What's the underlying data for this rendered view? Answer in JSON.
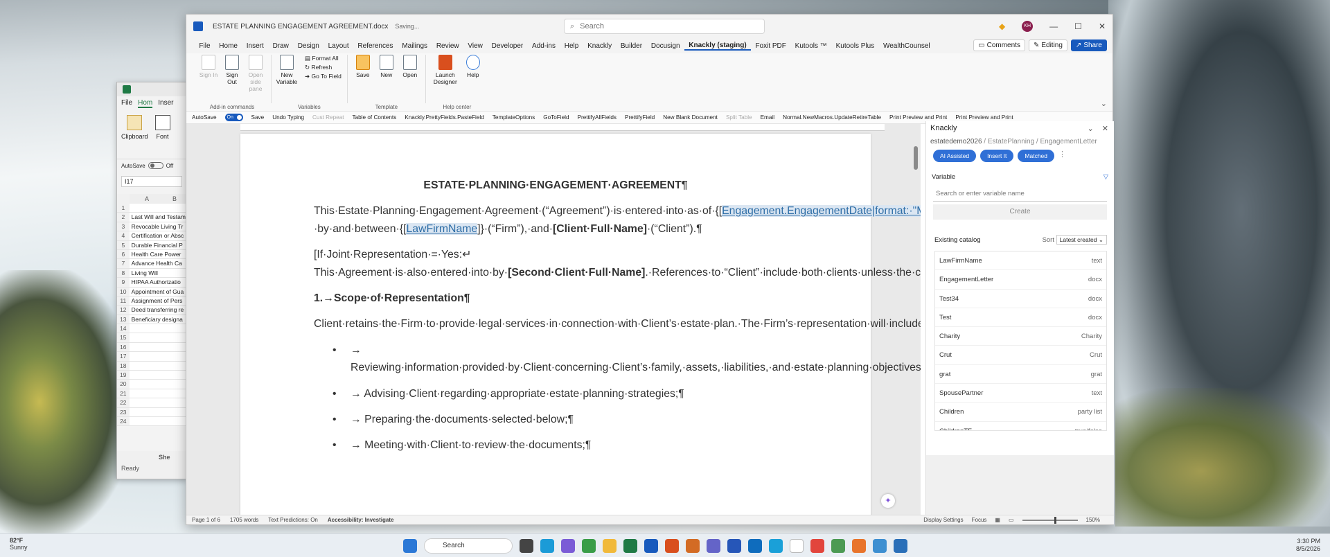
{
  "excel": {
    "tabs": [
      "File",
      "Hom",
      "Inser"
    ],
    "ribbon": [
      "Clipboard",
      "Font"
    ],
    "autosave": "AutoSave",
    "autosave_state": "Off",
    "namebox": "I17",
    "cols": [
      "A",
      "B"
    ],
    "rows": [
      {
        "n": "1",
        "v": ""
      },
      {
        "n": "2",
        "v": "Last Will and Testam"
      },
      {
        "n": "3",
        "v": "Revocable Living Tr"
      },
      {
        "n": "4",
        "v": "Certification or Absc"
      },
      {
        "n": "5",
        "v": "Durable Financial P"
      },
      {
        "n": "6",
        "v": "Health Care Power"
      },
      {
        "n": "7",
        "v": "Advance Health Ca"
      },
      {
        "n": "8",
        "v": "Living Will"
      },
      {
        "n": "9",
        "v": "HIPAA Authorizatio"
      },
      {
        "n": "10",
        "v": "Appointment of Gua"
      },
      {
        "n": "11",
        "v": "Assignment of Pers"
      },
      {
        "n": "12",
        "v": "Deed transferring re"
      },
      {
        "n": "13",
        "v": "Beneficiary designa"
      },
      {
        "n": "14",
        "v": ""
      },
      {
        "n": "15",
        "v": ""
      },
      {
        "n": "16",
        "v": ""
      },
      {
        "n": "17",
        "v": ""
      },
      {
        "n": "18",
        "v": ""
      },
      {
        "n": "19",
        "v": ""
      },
      {
        "n": "20",
        "v": ""
      },
      {
        "n": "21",
        "v": ""
      },
      {
        "n": "22",
        "v": ""
      },
      {
        "n": "23",
        "v": ""
      },
      {
        "n": "24",
        "v": ""
      }
    ],
    "status": "Ready",
    "sheet": "She"
  },
  "word": {
    "title": "ESTATE PLANNING ENGAGEMENT AGREEMENT.docx",
    "saving": "Saving...",
    "search_placeholder": "Search",
    "avatar": "KH",
    "menus": [
      "File",
      "Home",
      "Insert",
      "Draw",
      "Design",
      "Layout",
      "References",
      "Mailings",
      "Review",
      "View",
      "Developer",
      "Add-ins",
      "Help",
      "Knackly",
      "Builder",
      "Docusign",
      "Knackly (staging)",
      "Foxit PDF",
      "Kutools ™",
      "Kutools Plus",
      "WealthCounsel"
    ],
    "comments": "Comments",
    "editing": "Editing",
    "share": "Share",
    "ribbon": {
      "g1": {
        "label": "Add-in commands",
        "btns": [
          "Sign In",
          "Sign Out",
          "Open side pane"
        ]
      },
      "g2": {
        "label": "Variables",
        "btn": "New Variable",
        "small": [
          "Format All",
          "Refresh",
          "Go To Field"
        ]
      },
      "g3": {
        "label": "Template",
        "btns": [
          "Save",
          "New",
          "Open"
        ]
      },
      "g4": {
        "label": "Help center",
        "btns": [
          "Launch Designer",
          "Help"
        ]
      }
    },
    "qat": {
      "autosave": "AutoSave",
      "on": "On",
      "items": [
        "Save",
        "Undo Typing",
        "Cust Repeat",
        "Table of Contents",
        "Knackly.PrettyFields.PasteField",
        "TemplateOptions",
        "GoToField",
        "PrettifyAllFields",
        "PrettifyField",
        "New Blank Document",
        "Split Table",
        "Email",
        "Normal.NewMacros.UpdateRetireTable",
        "Print Preview and Print",
        "Print Preview and Print"
      ]
    },
    "doc": {
      "title": "ESTATE·PLANNING·ENGAGEMENT·AGREEMENT¶",
      "p1a": "This·Estate·Planning·Engagement·Agreement·(“Agreement”)·is·entered·into·as·of·",
      "p1b": "{[",
      "p1field": "Engagement.EngagementDate|format:·\"MMMM·D,·YYYY\"",
      "p1c": "]}·by·and·between·",
      "p1d": "{[",
      "p1field2": "LawFirmName",
      "p1e": "]}·(“Firm”),·and·",
      "p1bold": "[Client·Full·Name]",
      "p1f": "·(“Client”).¶",
      "p2a": "[If·Joint·Representation·=·Yes:↵",
      "p2b": "This·Agreement·is·also·entered·into·by·",
      "p2bold": "[Second·Client·Full·Name]",
      "p2c": ".·References·to·“Client”·include·both·clients·unless·the·context·requires·otherwise.]¶",
      "h1": "1.→Scope·of·Representation¶",
      "p3": "Client·retains·the·Firm·to·provide·legal·services·in·connection·with·Client’s·estate·plan.·The·Firm’s·representation·will·include·the·following·services:¶",
      "bullets": [
        "→ Reviewing·information·provided·by·Client·concerning·Client’s·family,·assets,·liabilities,·and·estate·planning·objectives;¶",
        "→ Advising·Client·regarding·appropriate·estate·planning·strategies;¶",
        "→ Preparing·the·documents·selected·below;¶",
        "→ Meeting·with·Client·to·review·the·documents;¶"
      ]
    },
    "status": {
      "page": "Page 1 of 6",
      "words": "1705 words",
      "pred": "Text Predictions: On",
      "access": "Accessibility: Investigate",
      "display": "Display Settings",
      "focus": "Focus",
      "zoom": "150%"
    }
  },
  "knackly": {
    "title": "Knackly",
    "crumb": [
      "estatedemo2026",
      "EstatePlanning",
      "EngagementLetter"
    ],
    "buttons": [
      "AI Assisted",
      "Insert It",
      "Matched"
    ],
    "variable_label": "Variable",
    "variable_placeholder": "Search or enter variable name",
    "create": "Create",
    "existing": "Existing catalog",
    "sort_label": "Sort",
    "sort_value": "Latest created",
    "items": [
      {
        "name": "LawFirmName",
        "type": "text"
      },
      {
        "name": "EngagementLetter",
        "type": "docx"
      },
      {
        "name": "Test34",
        "type": "docx"
      },
      {
        "name": "Test",
        "type": "docx"
      },
      {
        "name": "Charity",
        "type": "Charity"
      },
      {
        "name": "Crut",
        "type": "Crut"
      },
      {
        "name": "grat",
        "type": "grat"
      },
      {
        "name": "SpousePartner",
        "type": "text"
      },
      {
        "name": "Children",
        "type": "party list"
      },
      {
        "name": "ChildrenTF",
        "type": "true/false"
      }
    ]
  },
  "taskbar": {
    "temp": "82°F",
    "weather": "Sunny",
    "search": "Search",
    "time": "3:30 PM",
    "date": "8/5/2026"
  }
}
